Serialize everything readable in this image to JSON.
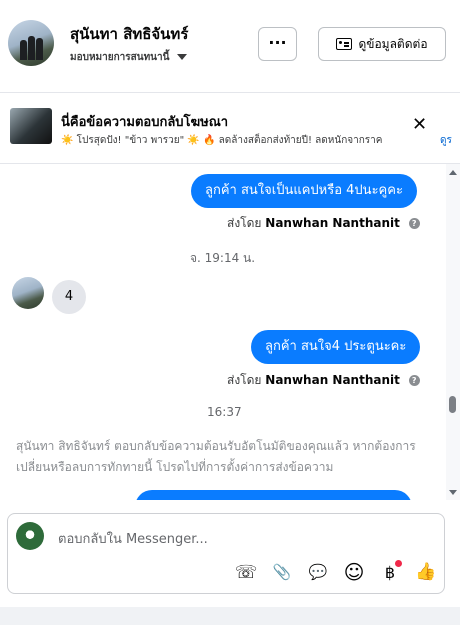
{
  "header": {
    "contact_name": "สุนันทา สิทธิจันทร์",
    "assign_label": "มอบหมายการสนทนานี้",
    "more_label": "···",
    "contact_info_label": "ดูข้อมูลติดต่อ"
  },
  "ad_reply": {
    "title": "นี่คือข้อความตอบกลับโฆษณา",
    "body": "☀️ โปรสุดปัง! \"ข้าว พารวย\" ☀️ 🔥 ลดล้างสต็อกส่งท้ายปี! ลดหนักจากราค",
    "more_label": "ดูร",
    "close_label": "✕"
  },
  "thread": {
    "msg1": "ลูกค้า สนใจเป็นแคปหรือ 4ปนะคูคะ",
    "sent_by_prefix": "ส่งโดย",
    "sender_name": "Nanwhan Nanthanit",
    "info_glyph": "?",
    "timestamp1": "จ. 19:14 น.",
    "incoming_msg": "4",
    "msg2": "ลูกค้า สนใจ4 ประตูนะคะ",
    "timestamp2": "16:37",
    "auto_note": "สุนันทา สิทธิจันทร์ ตอบกลับข้อความต้อนรับอัตโนมัติของคุณแล้ว หากต้องการเปลี่ยนหรือลบการทักทายนี้ โปรดไปที่การตั้งค่าการส่งข้อความ"
  },
  "composer": {
    "placeholder": "ตอบกลับใน Messenger...",
    "tools": {
      "call": "☏",
      "attach": "📎",
      "saved_reply": "💬",
      "emoji": "☺",
      "payment": "฿",
      "like": "👍"
    }
  },
  "colors": {
    "accent": "#0a7cff",
    "notification_dot": "#f02849"
  }
}
